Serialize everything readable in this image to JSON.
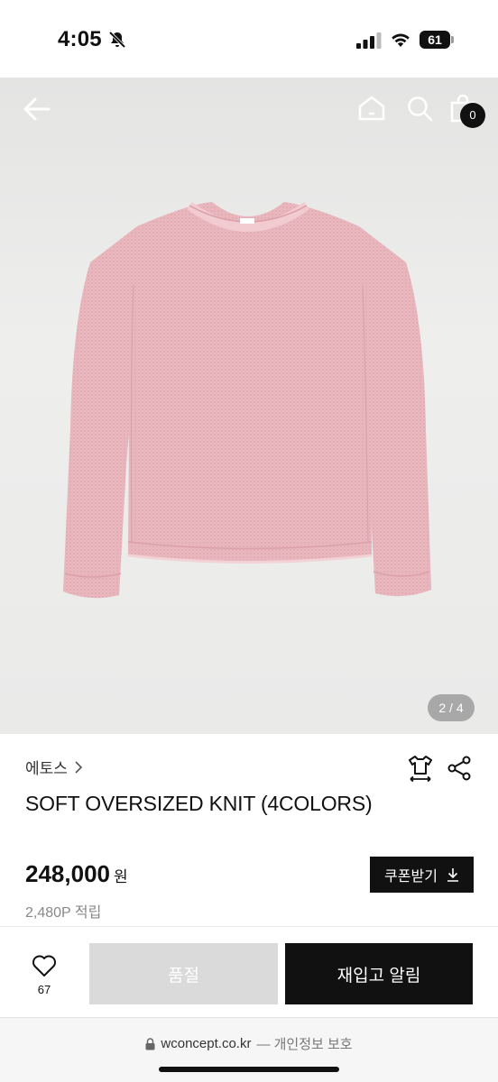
{
  "status": {
    "time": "4:05",
    "battery": "61"
  },
  "nav": {
    "cart_count": "0"
  },
  "gallery": {
    "counter": "2 / 4"
  },
  "product": {
    "brand": "에토스",
    "title": "SOFT OVERSIZED KNIT (4COLORS)",
    "price": "248,000",
    "currency": "원",
    "points": "2,480P 적립",
    "coupon_label": "쿠폰받기"
  },
  "actions": {
    "wish_count": "67",
    "soldout_label": "품절",
    "restock_label": "재입고 알림"
  },
  "browser": {
    "domain": "wconcept.co.kr",
    "privacy": "— 개인정보 보호"
  },
  "colors": {
    "accent": "#111111",
    "disabled": "#dadada",
    "sweater": "#e8b6bc"
  }
}
